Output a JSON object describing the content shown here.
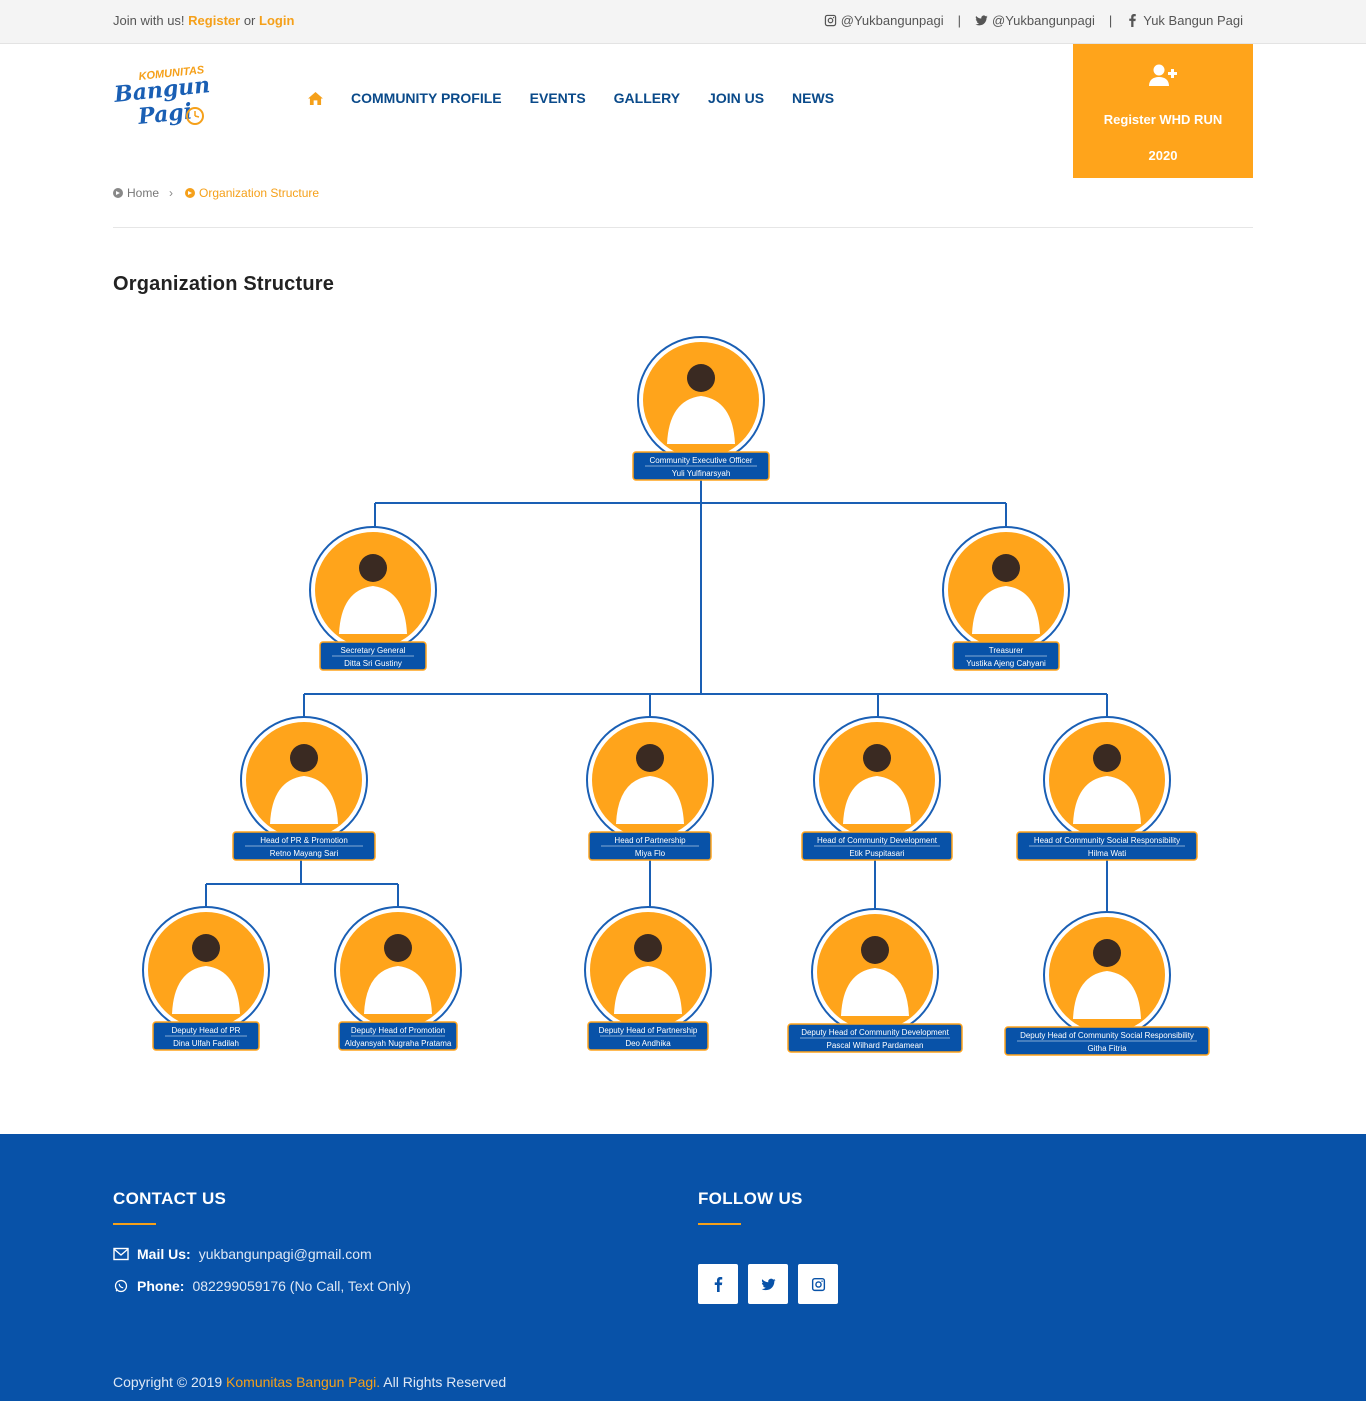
{
  "topbar": {
    "join_text": "Join with us!",
    "register": "Register",
    "or": "or",
    "login": "Login",
    "instagram": "@Yukbangunpagi",
    "twitter": "@Yukbangunpagi",
    "facebook": "Yuk Bangun Pagi",
    "separator": "|"
  },
  "logo": {
    "line1": "KOMUNITAS",
    "line2": "Bangun",
    "line3": "Pagi"
  },
  "nav": {
    "items": [
      "COMMUNITY PROFILE",
      "EVENTS",
      "GALLERY",
      "JOIN US",
      "NEWS"
    ]
  },
  "cta": {
    "label": "Register WHD RUN 2020"
  },
  "breadcrumb": {
    "home": "Home",
    "current": "Organization Structure"
  },
  "page": {
    "title": "Organization Structure"
  },
  "org": {
    "members": [
      {
        "role": "Community Executive Officer",
        "name": "Yuli Yulfinarsyah"
      },
      {
        "role": "Secretary General",
        "name": "Ditta Sri Gustiny"
      },
      {
        "role": "Treasurer",
        "name": "Yustika Ajeng Cahyani"
      },
      {
        "role": "Head of PR & Promotion",
        "name": "Retno Mayang Sari"
      },
      {
        "role": "Head of Partnership",
        "name": "Miya Flo"
      },
      {
        "role": "Head of Community Development",
        "name": "Etik Puspitasari"
      },
      {
        "role": "Head of Community Social Responsibility",
        "name": "Hilma Wati"
      },
      {
        "role": "Deputy Head of PR",
        "name": "Dina Ulfah Fadilah"
      },
      {
        "role": "Deputy Head of Promotion",
        "name": "Aldyansyah Nugraha Pratama"
      },
      {
        "role": "Deputy Head of Partnership",
        "name": "Deo Andhika"
      },
      {
        "role": "Deputy Head of Community Development",
        "name": "Pascal  Wilhard Pardamean"
      },
      {
        "role": "Deputy Head of Community Social Responsibility",
        "name": "Githa Fitria"
      }
    ]
  },
  "footer": {
    "contact_title": "CONTACT US",
    "follow_title": "FOLLOW US",
    "mail_label": "Mail Us:",
    "mail_value": "yukbangunpagi@gmail.com",
    "phone_label": "Phone:",
    "phone_value": "082299059176 (No Call, Text Only)",
    "copyright_prefix": "Copyright © 2019",
    "copyright_brand": "Komunitas Bangun Pagi.",
    "copyright_suffix": "All Rights Reserved"
  },
  "colors": {
    "accent": "#ffa41b",
    "brand_blue": "#0852a8",
    "nav_blue": "#0a4a8a"
  }
}
